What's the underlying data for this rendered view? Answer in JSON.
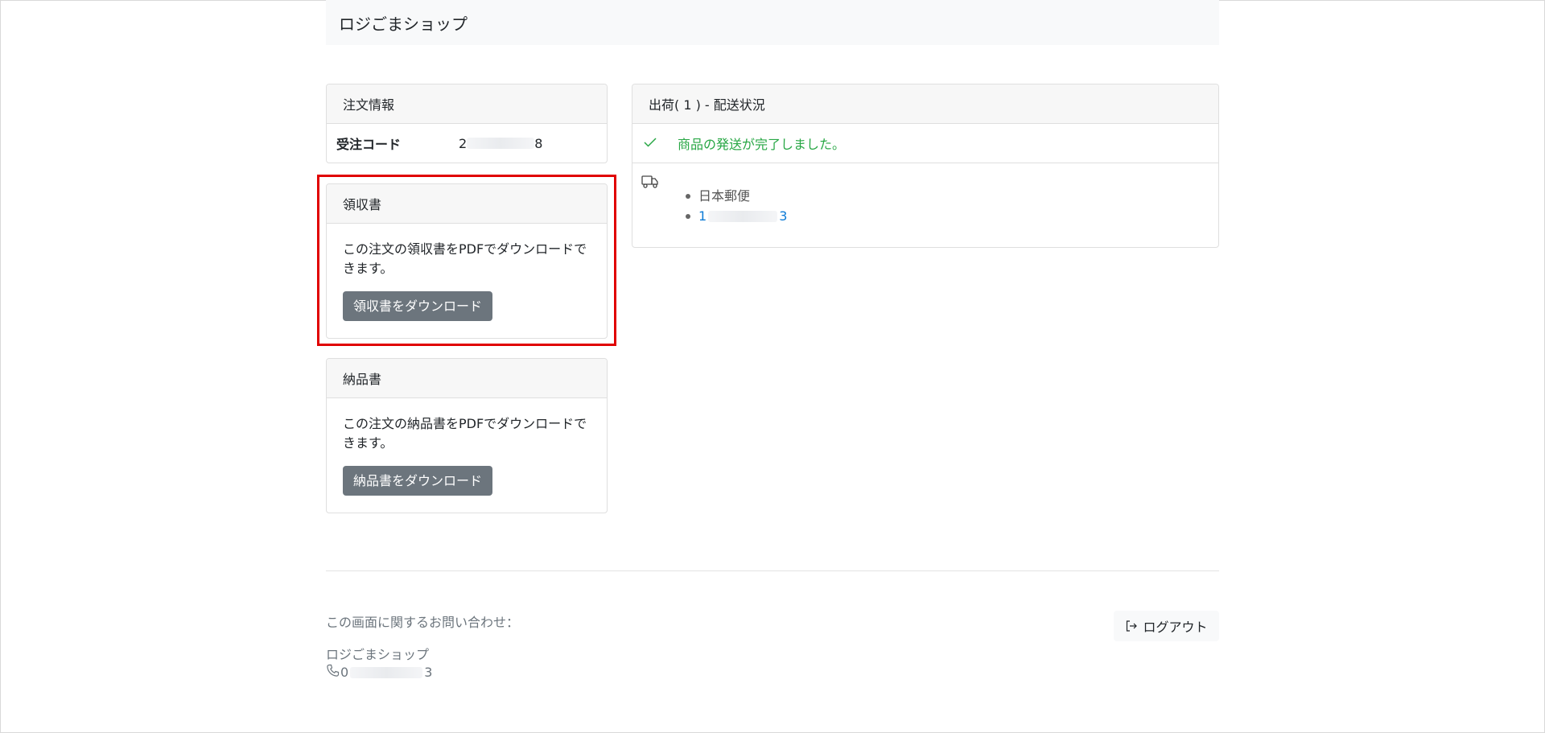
{
  "header": {
    "brand": "ロジごまショップ"
  },
  "order_info": {
    "title": "注文情報",
    "code_label": "受注コード",
    "code_prefix": "2",
    "code_suffix": "8"
  },
  "receipt": {
    "title": "領収書",
    "description": "この注文の領収書をPDFでダウンロードできます。",
    "button_label": "領収書をダウンロード"
  },
  "delivery_note": {
    "title": "納品書",
    "description": "この注文の納品書をPDFでダウンロードできます。",
    "button_label": "納品書をダウンロード"
  },
  "shipment": {
    "title": "出荷( 1 ) - 配送状況",
    "status_text": "商品の発送が完了しました。",
    "carrier": "日本郵便",
    "tracking_prefix": "1",
    "tracking_suffix": "3",
    "status_color": "#28a745",
    "link_color": "#0d7bd6"
  },
  "footer": {
    "contact_label": "この画面に関するお問い合わせ：",
    "shop_name": "ロジごまショップ",
    "phone_prefix": "0",
    "phone_suffix": "3",
    "logout_label": "ログアウト"
  },
  "colors": {
    "highlight": "#e00000",
    "button_bg": "#6c757d"
  }
}
